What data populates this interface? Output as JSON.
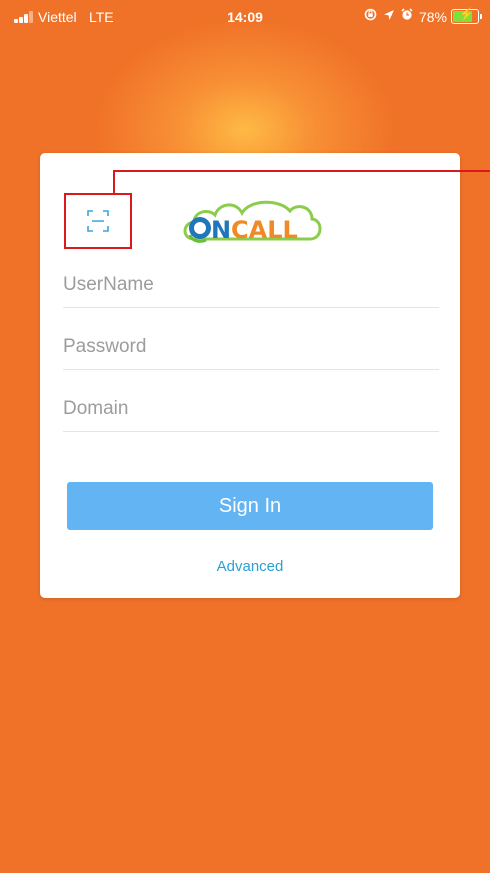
{
  "status_bar": {
    "carrier": "Viettel",
    "network": "LTE",
    "time": "14:09",
    "battery_percent": "78%",
    "battery_level": 0.78,
    "icons": [
      "signal-icon",
      "rotation-lock-icon",
      "location-arrow-icon",
      "alarm-icon",
      "battery-charging-icon"
    ]
  },
  "login": {
    "logo_icon": "oncall-logo-icon",
    "scan_icon": "qr-scan-icon",
    "username_placeholder": "UserName",
    "password_placeholder": "Password",
    "domain_placeholder": "Domain",
    "signin_label": "Sign In",
    "advanced_label": "Advanced"
  },
  "colors": {
    "background": "#f07228",
    "signin_button": "#62b4f2",
    "link": "#2aa0d4",
    "annotation": "#d9191c",
    "logo_blue": "#1f76b8",
    "logo_orange": "#f08a26"
  }
}
